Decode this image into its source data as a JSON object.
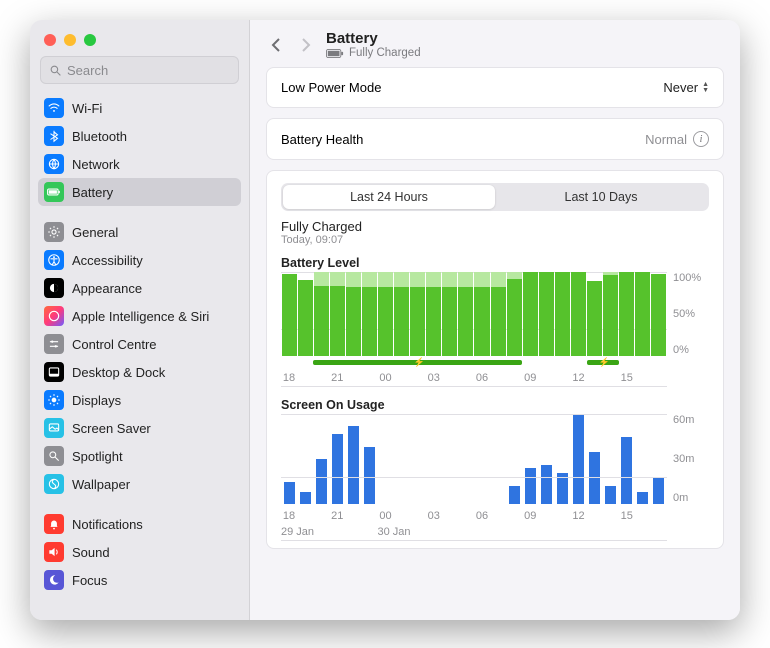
{
  "window": {
    "title": "Battery",
    "subtitle": "Fully Charged"
  },
  "search": {
    "placeholder": "Search"
  },
  "sidebar": {
    "groups": [
      [
        {
          "id": "wifi",
          "label": "Wi-Fi",
          "bg": "#0a7bff",
          "icon": "wifi"
        },
        {
          "id": "bluetooth",
          "label": "Bluetooth",
          "bg": "#0a7bff",
          "icon": "bluetooth"
        },
        {
          "id": "network",
          "label": "Network",
          "bg": "#0a7bff",
          "icon": "globe"
        },
        {
          "id": "battery",
          "label": "Battery",
          "bg": "#34c759",
          "icon": "battery",
          "selected": true
        }
      ],
      [
        {
          "id": "general",
          "label": "General",
          "bg": "#8e8e93",
          "icon": "gear"
        },
        {
          "id": "accessibility",
          "label": "Accessibility",
          "bg": "#0a7bff",
          "icon": "accessibility"
        },
        {
          "id": "appearance",
          "label": "Appearance",
          "bg": "#000000",
          "icon": "appearance"
        },
        {
          "id": "ai-siri",
          "label": "Apple Intelligence & Siri",
          "bg": "linear-gradient(135deg,#ff6a3c,#ff3b7b,#6f5cff)",
          "icon": "siri"
        },
        {
          "id": "control-centre",
          "label": "Control Centre",
          "bg": "#8e8e93",
          "icon": "controls"
        },
        {
          "id": "desktop-dock",
          "label": "Desktop & Dock",
          "bg": "#000000",
          "icon": "dock"
        },
        {
          "id": "displays",
          "label": "Displays",
          "bg": "#0a7bff",
          "icon": "displays"
        },
        {
          "id": "screen-saver",
          "label": "Screen Saver",
          "bg": "#27c1e6",
          "icon": "screensaver"
        },
        {
          "id": "spotlight",
          "label": "Spotlight",
          "bg": "#8e8e93",
          "icon": "search"
        },
        {
          "id": "wallpaper",
          "label": "Wallpaper",
          "bg": "#27c1e6",
          "icon": "wallpaper"
        }
      ],
      [
        {
          "id": "notifications",
          "label": "Notifications",
          "bg": "#ff3b30",
          "icon": "bell"
        },
        {
          "id": "sound",
          "label": "Sound",
          "bg": "#ff3b30",
          "icon": "sound"
        },
        {
          "id": "focus",
          "label": "Focus",
          "bg": "#5856d6",
          "icon": "moon"
        }
      ]
    ]
  },
  "settings": {
    "lowPowerMode": {
      "label": "Low Power Mode",
      "value": "Never"
    },
    "batteryHealth": {
      "label": "Battery Health",
      "value": "Normal"
    }
  },
  "segmented": {
    "a": "Last 24 Hours",
    "b": "Last 10 Days",
    "active": "a"
  },
  "statusBlock": {
    "title": "Fully Charged",
    "subtitle": "Today, 09:07"
  },
  "battery_chart_title": "Battery Level",
  "usage_chart_title": "Screen On Usage",
  "chart_data": [
    {
      "type": "bar",
      "title": "Battery Level",
      "ylabel": "%",
      "ylim": [
        0,
        100
      ],
      "y_ticks": [
        "100%",
        "50%",
        "0%"
      ],
      "x_hours": [
        18,
        19,
        20,
        21,
        22,
        23,
        0,
        1,
        2,
        3,
        4,
        5,
        6,
        7,
        8,
        9,
        10,
        11,
        12,
        13,
        14,
        15,
        16,
        17
      ],
      "x_tick_labels": [
        "18",
        "21",
        "00",
        "03",
        "06",
        "09",
        "12",
        "15"
      ],
      "series": [
        {
          "name": "level_pct",
          "values": [
            98,
            90,
            83,
            83,
            82,
            82,
            82,
            82,
            82,
            82,
            82,
            82,
            82,
            82,
            92,
            100,
            100,
            100,
            100,
            89,
            96,
            100,
            100,
            98
          ]
        },
        {
          "name": "charge_to_pct",
          "values": [
            0,
            0,
            100,
            100,
            100,
            100,
            100,
            100,
            100,
            100,
            100,
            100,
            100,
            100,
            100,
            0,
            0,
            0,
            0,
            0,
            100,
            100,
            0,
            0
          ]
        }
      ],
      "charging_intervals": [
        {
          "start_hour": 20,
          "end_hour": 33
        },
        {
          "start_hour": 37,
          "end_hour": 39
        }
      ],
      "date_labels": [
        {
          "at_hour": 18,
          "text": "29 Jan"
        },
        {
          "at_hour": 24,
          "text": "30 Jan"
        }
      ]
    },
    {
      "type": "bar",
      "title": "Screen On Usage",
      "ylabel": "minutes",
      "ylim": [
        0,
        60
      ],
      "y_ticks": [
        "60m",
        "30m",
        "0m"
      ],
      "x_hours": [
        18,
        19,
        20,
        21,
        22,
        23,
        0,
        1,
        2,
        3,
        4,
        5,
        6,
        7,
        8,
        9,
        10,
        11,
        12,
        13,
        14,
        15,
        16,
        17
      ],
      "x_tick_labels": [
        "18",
        "21",
        "00",
        "03",
        "06",
        "09",
        "12",
        "15"
      ],
      "series": [
        {
          "name": "screen_on_minutes",
          "values": [
            15,
            8,
            30,
            47,
            52,
            38,
            0,
            0,
            0,
            0,
            0,
            0,
            0,
            0,
            12,
            24,
            26,
            21,
            60,
            35,
            12,
            45,
            8,
            18
          ]
        }
      ],
      "date_labels": [
        {
          "at_hour": 18,
          "text": "29 Jan"
        },
        {
          "at_hour": 24,
          "text": "30 Jan"
        }
      ]
    }
  ]
}
